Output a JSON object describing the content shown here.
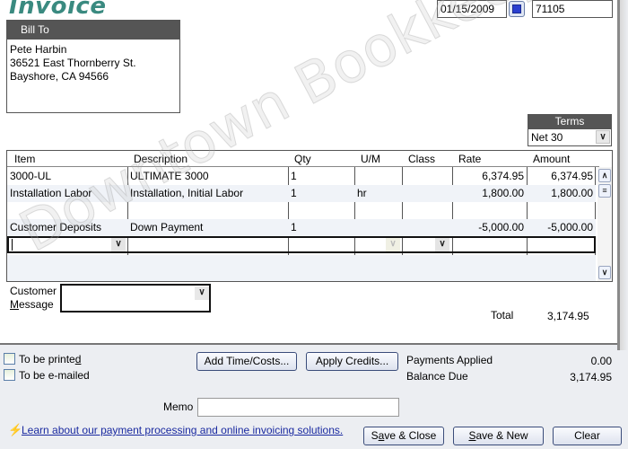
{
  "form": {
    "title": "Invoice",
    "date": "01/15/2009",
    "invoice_number": "71105",
    "bill_to": {
      "label": "Bill To",
      "lines": [
        "Pete Harbin",
        "36521 East Thornberry St.",
        "Bayshore, CA 94566"
      ]
    },
    "terms": {
      "label": "Terms",
      "value": "Net 30"
    }
  },
  "grid": {
    "columns": [
      "Item",
      "Description",
      "Qty",
      "U/M",
      "Class",
      "Rate",
      "Amount"
    ],
    "rows": [
      {
        "item": "3000-UL",
        "description": "ULTIMATE 3000",
        "qty": "1",
        "um": "",
        "class": "",
        "rate": "6,374.95",
        "amount": "6,374.95"
      },
      {
        "item": "Installation Labor",
        "description": "Installation, Initial Labor",
        "qty": "1",
        "um": "hr",
        "class": "",
        "rate": "1,800.00",
        "amount": "1,800.00"
      },
      {
        "item": "",
        "description": "",
        "qty": "",
        "um": "",
        "class": "",
        "rate": "",
        "amount": ""
      },
      {
        "item": "Customer Deposits",
        "description": "Down Payment",
        "qty": "1",
        "um": "",
        "class": "",
        "rate": "-5,000.00",
        "amount": "-5,000.00"
      }
    ]
  },
  "customer_message": {
    "label_line1": "Customer",
    "label_line2_underlined": "M",
    "label_line2_rest": "essage",
    "value": ""
  },
  "totals": {
    "total_label": "Total",
    "total_value": "3,174.95"
  },
  "options": {
    "to_be_printed": {
      "label_prefix": "To be printe",
      "label_underlined": "d",
      "checked": false
    },
    "to_be_emailed": {
      "label": "To be e-mailed",
      "checked": false
    }
  },
  "buttons": {
    "add_time_costs": "Add Time/Costs...",
    "apply_credits": "Apply Credits...",
    "save_close_prefix": "S",
    "save_close_underlined": "a",
    "save_close_rest": "ve & Close",
    "save_new_underlined": "S",
    "save_new_rest": "ave & New",
    "clear": "Clear"
  },
  "payments": {
    "payments_applied_label": "Payments Applied",
    "payments_applied_value": "0.00",
    "balance_due_label": "Balance Due",
    "balance_due_value": "3,174.95"
  },
  "memo": {
    "label": "Memo",
    "value": ""
  },
  "promo": {
    "icon": "lightning-icon",
    "link_text": "Learn about our payment processing and online invoicing solutions."
  },
  "watermark": "Downtown Bookkeeping"
}
